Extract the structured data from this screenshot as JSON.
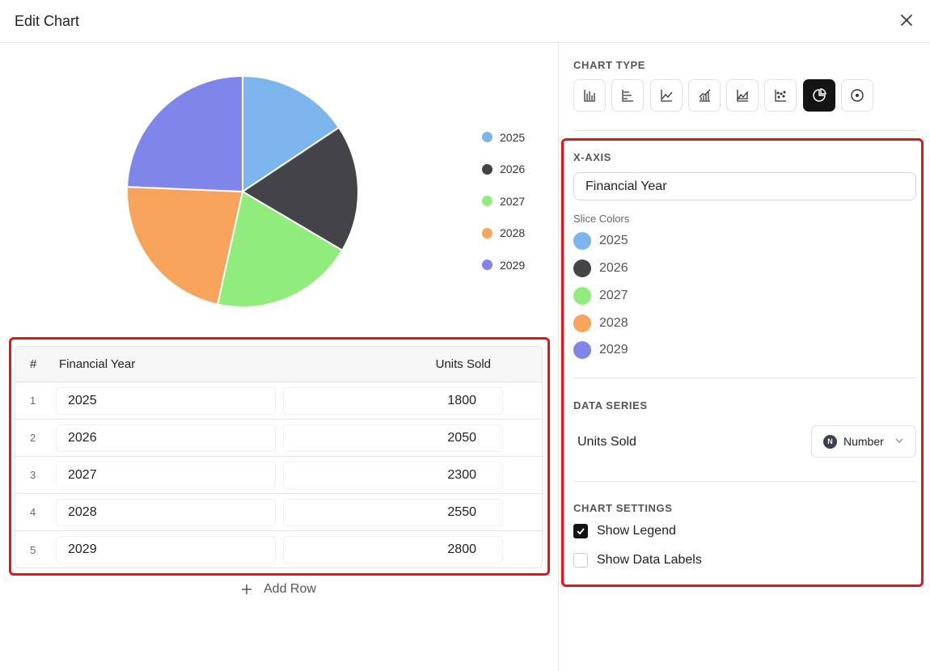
{
  "dialog": {
    "title": "Edit Chart",
    "close_icon": "close-icon"
  },
  "chart_data": {
    "type": "pie",
    "categories": [
      "2025",
      "2026",
      "2027",
      "2028",
      "2029"
    ],
    "values": [
      1800,
      2050,
      2300,
      2550,
      2800
    ],
    "colors": [
      "#7cb5ec",
      "#434348",
      "#90ed7d",
      "#f7a35c",
      "#8085e9"
    ],
    "legend": true,
    "legend_position": "right",
    "data_labels": false
  },
  "table": {
    "headers": {
      "num": "#",
      "year": "Financial Year",
      "units": "Units Sold"
    },
    "rows": [
      {
        "num": "1",
        "year": "2025",
        "units": "1800"
      },
      {
        "num": "2",
        "year": "2026",
        "units": "2050"
      },
      {
        "num": "3",
        "year": "2027",
        "units": "2300"
      },
      {
        "num": "4",
        "year": "2028",
        "units": "2550"
      },
      {
        "num": "5",
        "year": "2029",
        "units": "2800"
      }
    ],
    "add_row_label": "Add Row"
  },
  "panel": {
    "chart_type_label": "CHART TYPE",
    "chart_types": [
      {
        "icon": "bar-chart-icon",
        "active": false
      },
      {
        "icon": "horizontal-bar-chart-icon",
        "active": false
      },
      {
        "icon": "line-chart-icon",
        "active": false
      },
      {
        "icon": "combo-chart-icon",
        "active": false
      },
      {
        "icon": "area-chart-icon",
        "active": false
      },
      {
        "icon": "scatter-chart-icon",
        "active": false
      },
      {
        "icon": "pie-chart-icon",
        "active": true
      },
      {
        "icon": "donut-chart-icon",
        "active": false
      }
    ],
    "xaxis_label": "X-AXIS",
    "xaxis_value": "Financial Year",
    "slice_colors_label": "Slice Colors",
    "slices": [
      {
        "label": "2025",
        "color": "#7cb5ec"
      },
      {
        "label": "2026",
        "color": "#434348"
      },
      {
        "label": "2027",
        "color": "#90ed7d"
      },
      {
        "label": "2028",
        "color": "#f7a35c"
      },
      {
        "label": "2029",
        "color": "#8085e9"
      }
    ],
    "data_series_label": "DATA SERIES",
    "series_name": "Units Sold",
    "series_type_badge": "N",
    "series_type": "Number",
    "chart_settings_label": "CHART SETTINGS",
    "show_legend_label": "Show Legend",
    "show_legend": true,
    "show_data_labels_label": "Show Data Labels",
    "show_data_labels": false
  }
}
